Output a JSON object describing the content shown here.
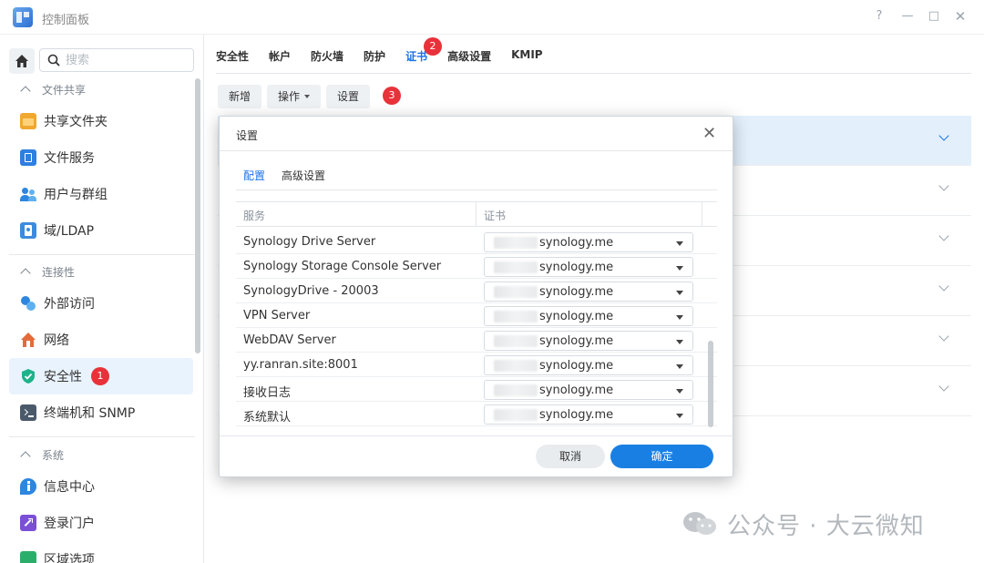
{
  "window": {
    "title": "控制面板",
    "controls": {
      "help": "?",
      "minimize": "—",
      "maximize": "□",
      "close": "✕"
    }
  },
  "sidebar": {
    "search_placeholder": "搜索",
    "sections": [
      {
        "label": "文件共享",
        "items": [
          {
            "label": "共享文件夹",
            "icon": "folder-share-icon",
            "color": "#f0a830"
          },
          {
            "label": "文件服务",
            "icon": "file-services-icon",
            "color": "#2e7fe0"
          },
          {
            "label": "用户与群组",
            "icon": "users-icon",
            "color": "#2e86de"
          },
          {
            "label": "域/LDAP",
            "icon": "ldap-icon",
            "color": "#3d8bdc"
          }
        ]
      },
      {
        "label": "连接性",
        "items": [
          {
            "label": "外部访问",
            "icon": "external-access-icon",
            "color": "#2e86de"
          },
          {
            "label": "网络",
            "icon": "network-home-icon",
            "color": "#e36b3a"
          },
          {
            "label": "安全性",
            "icon": "shield-check-icon",
            "color": "#1db28a",
            "active": true,
            "badge": "1"
          },
          {
            "label": "终端机和 SNMP",
            "icon": "terminal-icon",
            "color": "#4a5a6a"
          }
        ]
      },
      {
        "label": "系统",
        "items": [
          {
            "label": "信息中心",
            "icon": "info-icon",
            "color": "#2e86de"
          },
          {
            "label": "登录门户",
            "icon": "login-portal-icon",
            "color": "#7b4fd6"
          },
          {
            "label": "区域选项",
            "icon": "regional-icon",
            "color": "#2cae6b"
          }
        ]
      }
    ]
  },
  "main": {
    "tabs": [
      {
        "label": "安全性"
      },
      {
        "label": "帐户"
      },
      {
        "label": "防火墙"
      },
      {
        "label": "防护"
      },
      {
        "label": "证书",
        "active": true,
        "badge": "2"
      },
      {
        "label": "高级设置"
      },
      {
        "label": "KMIP"
      }
    ],
    "toolbar": {
      "add": "新增",
      "action": "操作",
      "settings": "设置",
      "settings_badge": "3"
    }
  },
  "dialog": {
    "title": "设置",
    "tabs": [
      {
        "label": "配置",
        "active": true
      },
      {
        "label": "高级设置"
      }
    ],
    "columns": {
      "service": "服务",
      "certificate": "证书"
    },
    "rows": [
      {
        "service": "Synology Drive Server",
        "cert": "synology.me"
      },
      {
        "service": "Synology Storage Console Server",
        "cert": "synology.me"
      },
      {
        "service": "SynologyDrive - 20003",
        "cert": "synology.me"
      },
      {
        "service": "VPN Server",
        "cert": "synology.me"
      },
      {
        "service": "WebDAV Server",
        "cert": "synology.me"
      },
      {
        "service": "yy.ranran.site:8001",
        "cert": "synology.me"
      },
      {
        "service": "接收日志",
        "cert": "synology.me"
      },
      {
        "service": "系统默认",
        "cert": "synology.me"
      }
    ],
    "cancel": "取消",
    "ok": "确定"
  },
  "watermark": {
    "text": "公众号 · 大云微知"
  },
  "colors": {
    "accent": "#1a73e8",
    "primary_button": "#1a7fe3",
    "badge": "#e8323a",
    "selected_row": "#e3f0fc"
  }
}
